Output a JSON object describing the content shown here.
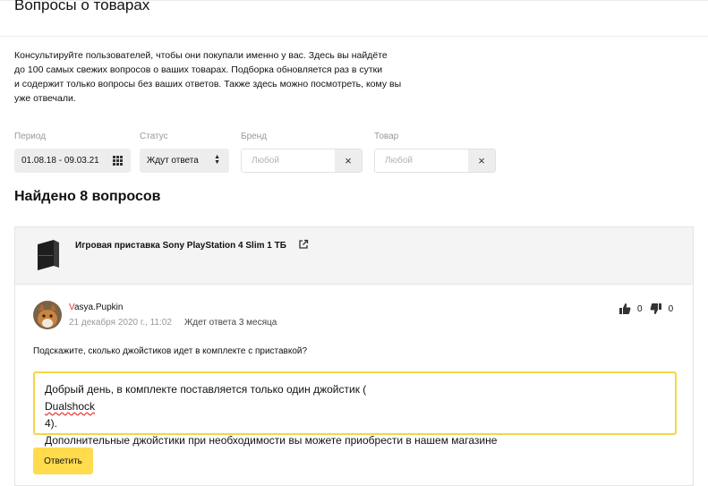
{
  "page": {
    "title": "Вопросы о товарах",
    "intro": [
      "Консультируйте пользователей, чтобы они покупали именно у вас. Здесь вы найдёте",
      "до 100 самых свежих вопросов о ваших товарах. Подборка обновляется раз в сутки",
      "и содержит только вопросы без ваших ответов. Также здесь можно посмотреть, кому вы",
      "уже отвечали."
    ]
  },
  "filters": {
    "period": {
      "label": "Период",
      "value": "01.08.18 - 09.03.21",
      "icon": "calendar-icon"
    },
    "status": {
      "label": "Статус",
      "value": "Ждут ответа",
      "icon": "sort-arrows-icon"
    },
    "brand": {
      "label": "Бренд",
      "placeholder": "Любой",
      "clear": "×"
    },
    "product": {
      "label": "Товар",
      "placeholder": "Любой",
      "clear": "×"
    }
  },
  "results": {
    "found": "Найдено 8 вопросов"
  },
  "question_card": {
    "product": {
      "name": "Игровая приставка Sony PlayStation 4 Slim 1 ТБ",
      "icon": "external-link-icon"
    },
    "user": {
      "first_letter": "V",
      "rest": "asya.Pupkin"
    },
    "date": "21 декабря 2020 г., 11:02",
    "status": "Ждет ответа 3 месяца",
    "likes": "0",
    "dislikes": "0",
    "question": "Подскажите, сколько джойстиков идет в комплекте с приставкой?",
    "answer": {
      "line1_before": "Добрый день, в комплекте поставляется только один джойстик (",
      "line1_word": "Dualshock",
      "line1_after": " 4).",
      "line2": "Дополнительные джойстики при необходимости вы можете приобрести в нашем магазине"
    },
    "reply_label": "Ответить"
  },
  "colors": {
    "accent": "#ffdb4d",
    "focus_border": "#f5d546",
    "username_first": "#e62e2e",
    "muted": "#999999"
  }
}
